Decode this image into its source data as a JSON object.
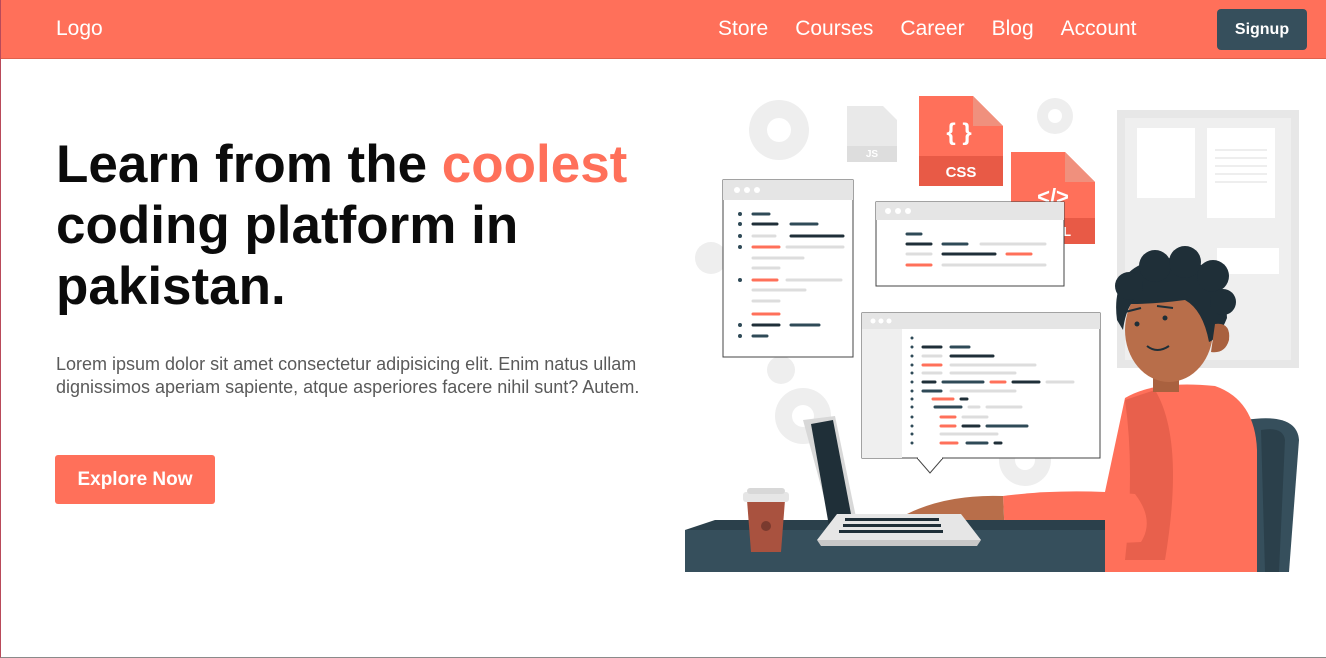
{
  "nav": {
    "logo": "Logo",
    "links": [
      "Store",
      "Courses",
      "Career",
      "Blog",
      "Account"
    ],
    "signup_label": "Signup"
  },
  "hero": {
    "title_part1": "Learn from the ",
    "title_accent": "coolest",
    "title_part2": " coding platform in pakistan.",
    "description": "Lorem ipsum dolor sit amet consectetur adipisicing elit. Enim natus ullam dignissimos aperiam sapiente, atque asperiores facere nihil sunt? Autem.",
    "cta_label": "Explore Now"
  },
  "illustration": {
    "file_labels": [
      "CSS",
      "JS",
      "HTML"
    ],
    "icons": [
      "code-window",
      "css-file-icon",
      "html-file-icon",
      "js-file-icon",
      "gear-icon",
      "laptop",
      "coffee-cup"
    ]
  },
  "colors": {
    "primary": "#ff705a",
    "dark": "#364f5c",
    "text": "#0b0b0b",
    "muted": "#5a5a5a"
  }
}
